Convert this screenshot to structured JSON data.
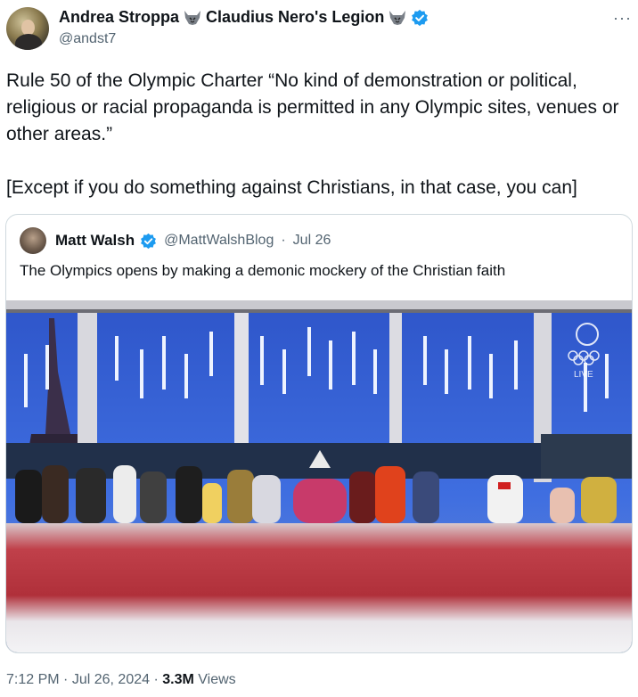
{
  "author": {
    "name": "Andrea Stroppa",
    "legion": "Claudius Nero's Legion",
    "handle": "@andst7",
    "icons": [
      "wolf-icon",
      "wolf-icon",
      "verified-badge-icon"
    ]
  },
  "more_label": "···",
  "tweet": {
    "paragraph1": "Rule 50 of the Olympic Charter “No kind of demonstration or political, religious or racial propaganda is permitted in any Olympic sites, venues or other areas.”",
    "paragraph2": "[Except if you do something against Christians, in that case, you can]"
  },
  "quote": {
    "name": "Matt Walsh",
    "handle": "@MattWalshBlog",
    "separator": "·",
    "date": "Jul 26",
    "text": "The Olympics opens by making a demonic mockery of the Christian faith",
    "media_overlay": "LIVE"
  },
  "footer": {
    "time": "7:12 PM",
    "separator": "·",
    "date": "Jul 26, 2024",
    "views_count": "3.3M",
    "views_label": "Views"
  },
  "colors": {
    "text": "#0f1419",
    "secondary": "#536471",
    "verified": "#1d9bf0",
    "border": "#cfd9de"
  }
}
